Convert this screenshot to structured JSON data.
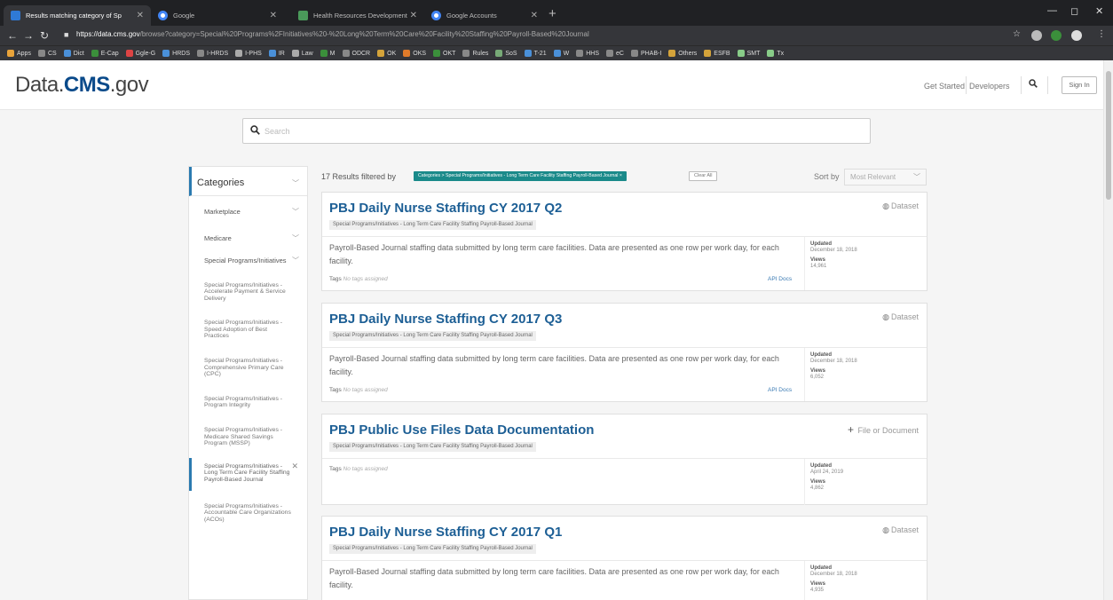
{
  "browser": {
    "tabs": [
      {
        "title": "Results matching category of Sp",
        "active": true
      },
      {
        "title": "Google",
        "active": false
      },
      {
        "title": "Health Resources Development",
        "active": false
      },
      {
        "title": "Google Accounts",
        "active": false
      }
    ],
    "url_domain": "https://data.cms.gov",
    "url_path": "/browse?category=Special%20Programs%2FInitiatives%20-%20Long%20Term%20Care%20Facility%20Staffing%20Payroll-Based%20Journal",
    "bookmarks": [
      "Apps",
      "CS",
      "Dict",
      "E-Cap",
      "Ggle-G",
      "HRDS",
      "I-HRDS",
      "I-PHS",
      "IR",
      "Law",
      "M",
      "ODCR",
      "OK",
      "OKS",
      "OKT",
      "Rules",
      "SoS",
      "T-21",
      "W",
      "HHS",
      "eC",
      "PHAB-I",
      "Others",
      "ESFB",
      "SMT",
      "Tx"
    ]
  },
  "header": {
    "logo_prefix": "Data.",
    "logo_bold": "CMS",
    "logo_suffix": ".gov",
    "get_started": "Get Started",
    "developers": "Developers",
    "sign_in": "Sign In"
  },
  "search": {
    "placeholder": "Search"
  },
  "sidebar": {
    "heading": "Categories",
    "top_items": [
      {
        "label": "Marketplace"
      },
      {
        "label": "Medicare"
      },
      {
        "label": "Special Programs/Initiatives"
      }
    ],
    "sub_items": [
      {
        "label": "Special Programs/Initiatives - Accelerate Payment & Service Delivery"
      },
      {
        "label": "Special Programs/Initiatives - Speed Adoption of Best Practices"
      },
      {
        "label": "Special Programs/Initiatives - Comprehensive Primary Care (CPC)"
      },
      {
        "label": "Special Programs/Initiatives - Program Integrity"
      },
      {
        "label": "Special Programs/Initiatives - Medicare Shared Savings Program (MSSP)"
      },
      {
        "label": "Special Programs/Initiatives - Long Term Care Facility Staffing Payroll-Based Journal",
        "active": true
      },
      {
        "label": "Special Programs/Initiatives - Accountable Care Organizations (ACOs)"
      }
    ]
  },
  "results": {
    "count_text": "17 Results filtered by",
    "filter_chip": "Categories > Special Programs/Initiatives - Long Term Care Facility Staffing Payroll-Based Journal ×",
    "clear_all": "Clear All",
    "sort_label": "Sort by",
    "sort_value": "Most Relevant",
    "tags_label": "Tags",
    "no_tags": "No tags assigned",
    "updated_label": "Updated",
    "views_label": "Views",
    "api_docs": "API Docs",
    "items": [
      {
        "title": "PBJ Daily Nurse Staffing CY 2017 Q2",
        "category": "Special Programs/Initiatives - Long Term Care Facility Staffing Payroll-Based Journal",
        "type": "Dataset",
        "description": "Payroll-Based Journal staffing data submitted by long term care facilities. Data are presented as one row per work day, for each facility.",
        "updated": "December 18, 2018",
        "views": "14,961"
      },
      {
        "title": "PBJ Daily Nurse Staffing CY 2017 Q3",
        "category": "Special Programs/Initiatives - Long Term Care Facility Staffing Payroll-Based Journal",
        "type": "Dataset",
        "description": "Payroll-Based Journal staffing data submitted by long term care facilities. Data are presented as one row per work day, for each facility.",
        "updated": "December 18, 2018",
        "views": "6,052"
      },
      {
        "title": "PBJ Public Use Files Data Documentation",
        "category": "Special Programs/Initiatives - Long Term Care Facility Staffing Payroll-Based Journal",
        "type": "File or Document",
        "description": "",
        "updated": "April 24, 2019",
        "views": "4,862"
      },
      {
        "title": "PBJ Daily Nurse Staffing CY 2017 Q1",
        "category": "Special Programs/Initiatives - Long Term Care Facility Staffing Payroll-Based Journal",
        "type": "Dataset",
        "description": "Payroll-Based Journal staffing data submitted by long term care facilities. Data are presented as one row per work day, for each facility.",
        "updated": "December 18, 2018",
        "views": "4,935"
      }
    ]
  },
  "colors": {
    "accent": "#2a7ab0",
    "chip": "#1a8a8a",
    "title": "#1d5f95",
    "brand": "#0a4a8a"
  }
}
